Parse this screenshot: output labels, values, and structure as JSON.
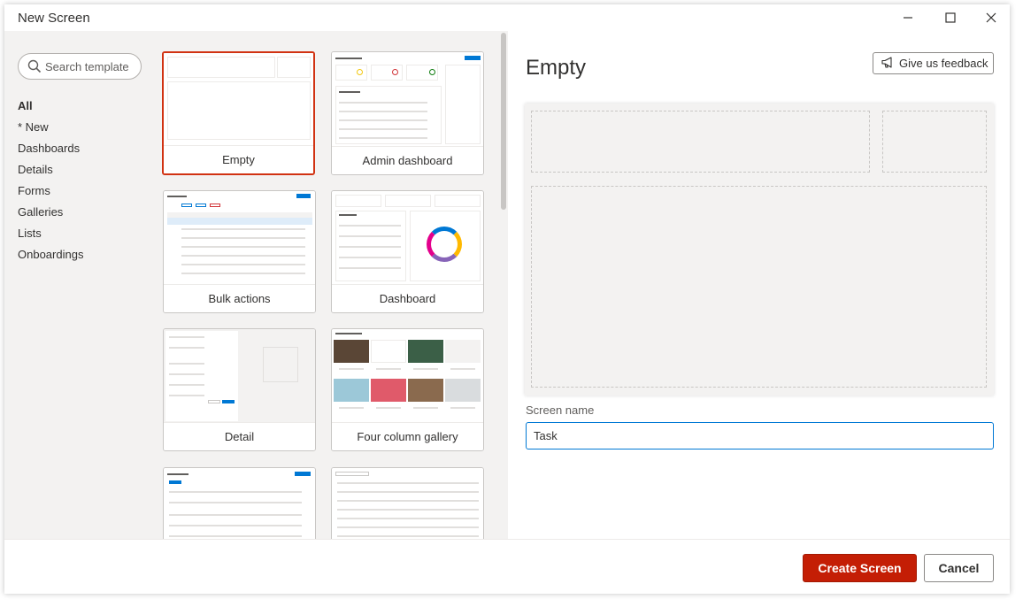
{
  "window": {
    "title": "New Screen",
    "controls": [
      "minimize-icon",
      "maximize-icon",
      "close-icon"
    ]
  },
  "search": {
    "placeholder": "Search template",
    "icon": "search-icon"
  },
  "categories": [
    {
      "label": "All",
      "active": true
    },
    {
      "label": "* New",
      "active": false
    },
    {
      "label": "Dashboards",
      "active": false
    },
    {
      "label": "Details",
      "active": false
    },
    {
      "label": "Forms",
      "active": false
    },
    {
      "label": "Galleries",
      "active": false
    },
    {
      "label": "Lists",
      "active": false
    },
    {
      "label": "Onboardings",
      "active": false
    }
  ],
  "templates": [
    {
      "label": "Empty",
      "selected": true
    },
    {
      "label": "Admin dashboard",
      "selected": false
    },
    {
      "label": "Bulk actions",
      "selected": false
    },
    {
      "label": "Dashboard",
      "selected": false
    },
    {
      "label": "Detail",
      "selected": false
    },
    {
      "label": "Four column gallery",
      "selected": false
    },
    {
      "label": "",
      "selected": false
    },
    {
      "label": "",
      "selected": false
    }
  ],
  "preview": {
    "title": "Empty",
    "feedback_label": "Give us feedback",
    "feedback_icon": "megaphone-icon"
  },
  "screen_name": {
    "label": "Screen name",
    "value": "Task"
  },
  "footer": {
    "create_label": "Create Screen",
    "cancel_label": "Cancel"
  },
  "colors": {
    "accent": "#c41e05",
    "selected_border": "#d13212",
    "focus_border": "#0078d4",
    "pane_bg": "#f3f2f1"
  }
}
